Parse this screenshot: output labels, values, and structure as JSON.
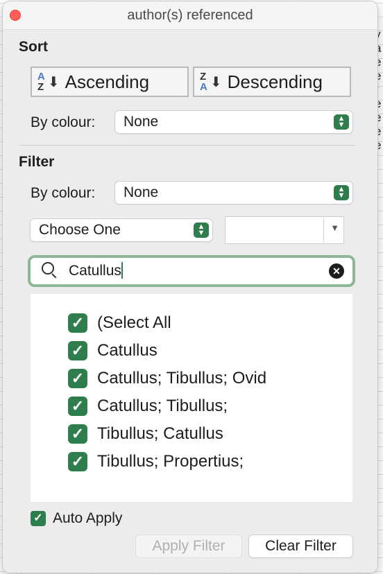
{
  "window": {
    "title": "author(s) referenced"
  },
  "sort": {
    "heading": "Sort",
    "ascending_label": "Ascending",
    "descending_label": "Descending",
    "by_colour_label": "By colour:",
    "by_colour_value": "None"
  },
  "filter": {
    "heading": "Filter",
    "by_colour_label": "By colour:",
    "by_colour_value": "None",
    "condition_value": "Choose One",
    "condition_input_value": ""
  },
  "search": {
    "value": "Catullus"
  },
  "list": {
    "items": [
      {
        "label": "(Select All",
        "checked": true
      },
      {
        "label": "Catullus",
        "checked": true
      },
      {
        "label": "Catullus; Tibullus; Ovid",
        "checked": true
      },
      {
        "label": "Catullus; Tibullus;",
        "checked": true
      },
      {
        "label": "Tibullus; Catullus",
        "checked": true
      },
      {
        "label": "Tibullus; Propertius;",
        "checked": true
      }
    ]
  },
  "footer": {
    "auto_apply_label": "Auto Apply",
    "auto_apply_checked": true,
    "apply_filter_label": "Apply Filter",
    "clear_filter_label": "Clear Filter"
  },
  "background": {
    "edge_letters": [
      "y",
      "a",
      "e",
      "e",
      "r",
      "e",
      "e",
      "e",
      "e"
    ]
  },
  "colors": {
    "accent": "#2f7d4d",
    "close": "#fe5f57",
    "search_focus": "#8eb798"
  },
  "icons": [
    "close-icon",
    "sort-az-icon",
    "sort-za-icon",
    "stepper-icon",
    "search-icon",
    "clear-search-icon",
    "checkbox-checked-icon",
    "dropdown-arrow-icon"
  ]
}
